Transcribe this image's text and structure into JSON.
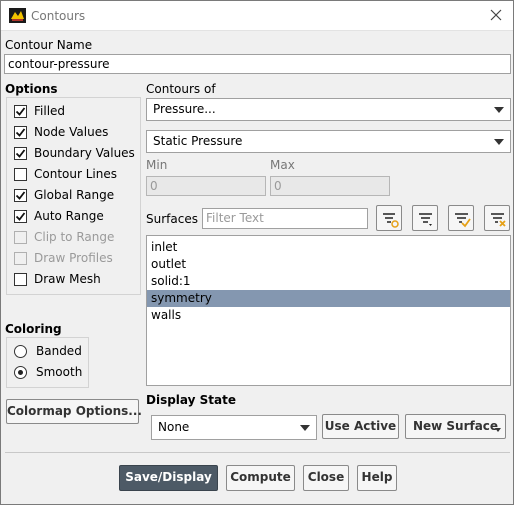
{
  "window": {
    "title": "Contours"
  },
  "contour_name": {
    "label": "Contour Name",
    "value": "contour-pressure"
  },
  "options": {
    "heading": "Options",
    "items": [
      {
        "label": "Filled",
        "checked": true,
        "enabled": true
      },
      {
        "label": "Node Values",
        "checked": true,
        "enabled": true
      },
      {
        "label": "Boundary Values",
        "checked": true,
        "enabled": true
      },
      {
        "label": "Contour Lines",
        "checked": false,
        "enabled": true
      },
      {
        "label": "Global Range",
        "checked": true,
        "enabled": true
      },
      {
        "label": "Auto Range",
        "checked": true,
        "enabled": true
      },
      {
        "label": "Clip to Range",
        "checked": false,
        "enabled": false
      },
      {
        "label": "Draw Profiles",
        "checked": false,
        "enabled": false
      },
      {
        "label": "Draw Mesh",
        "checked": false,
        "enabled": true
      }
    ]
  },
  "coloring": {
    "heading": "Coloring",
    "options": [
      {
        "label": "Banded",
        "selected": false
      },
      {
        "label": "Smooth",
        "selected": true
      }
    ]
  },
  "colormap_button": "Colormap Options...",
  "contours_of": {
    "label": "Contours of",
    "category": "Pressure...",
    "quantity": "Static Pressure"
  },
  "range": {
    "min_label": "Min",
    "max_label": "Max",
    "min_value": "0",
    "max_value": "0"
  },
  "surfaces": {
    "label": "Surfaces",
    "filter_placeholder": "Filter Text",
    "items": [
      "inlet",
      "outlet",
      "solid:1",
      "symmetry",
      "walls"
    ],
    "selected_index": 3,
    "icons": [
      "list-select-icon",
      "list-dropdown-icon",
      "select-all-icon",
      "deselect-all-icon"
    ]
  },
  "display_state": {
    "label": "Display State",
    "value": "None",
    "use_active": "Use Active",
    "new_surface": "New Surface"
  },
  "footer": {
    "save_display": "Save/Display",
    "compute": "Compute",
    "close": "Close",
    "help": "Help"
  },
  "colors": {
    "selected_row": "#8497b0",
    "primary_button": "#4d5a66",
    "icon_accent": "#e6a117"
  }
}
